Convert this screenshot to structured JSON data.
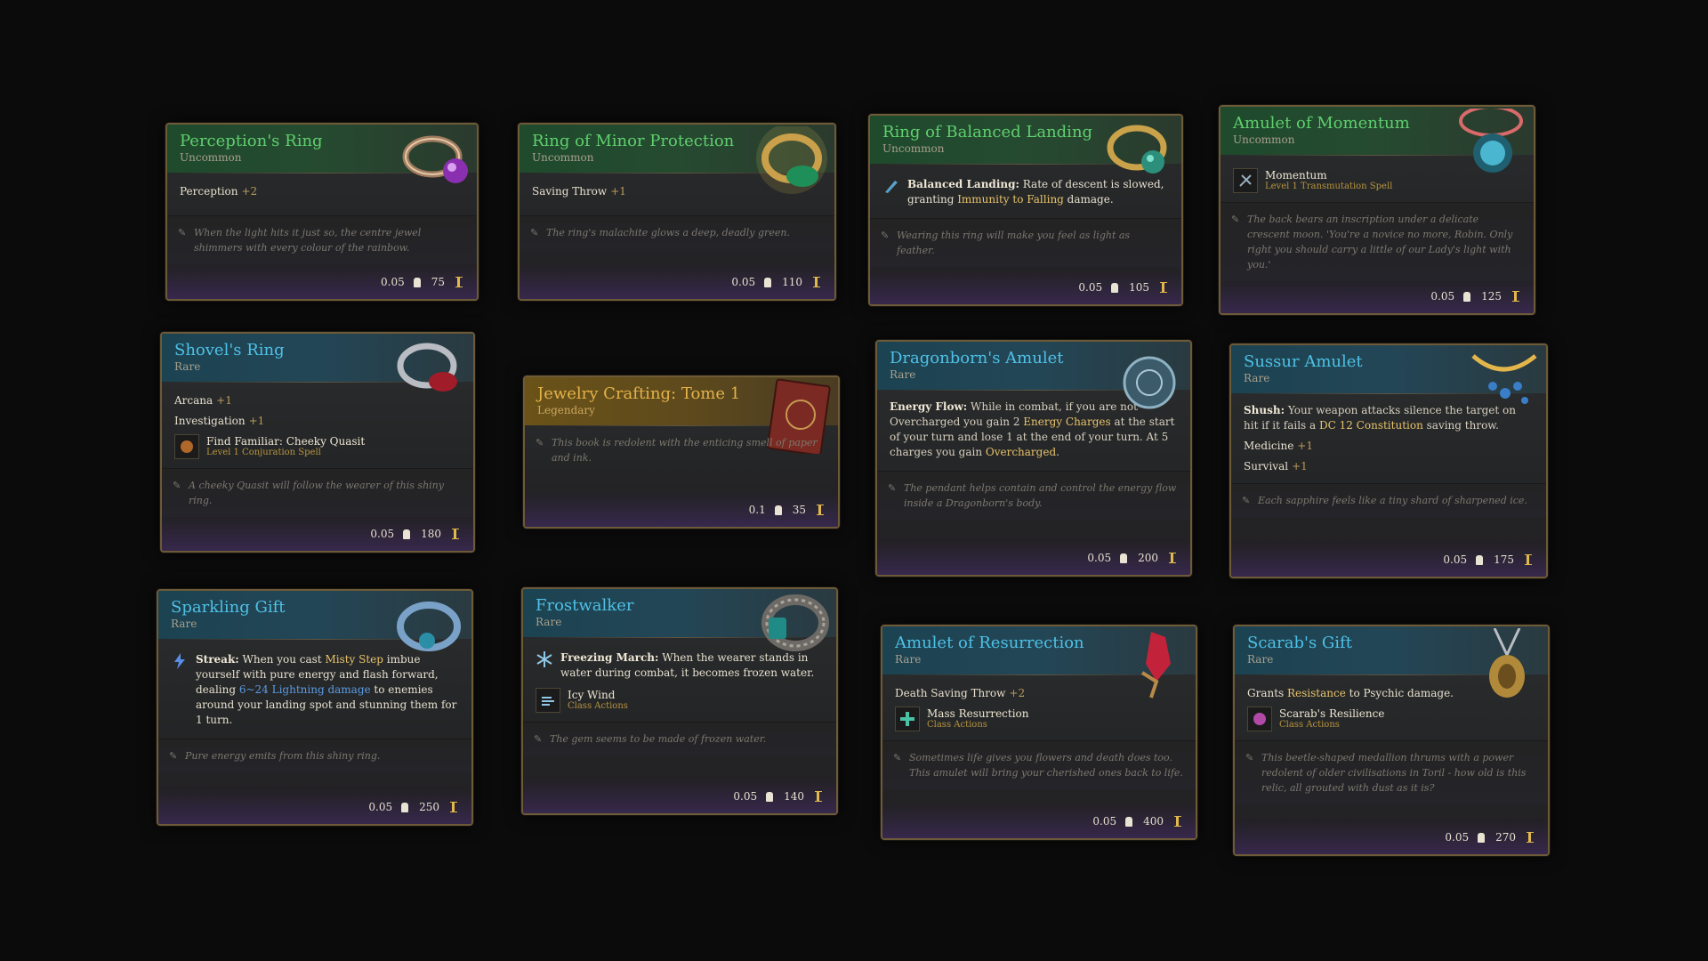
{
  "cards": [
    {
      "title": "Perception's Ring",
      "rarity": "Uncommon",
      "stats": [
        {
          "label": "Perception",
          "bonus": "+2"
        }
      ],
      "flavor": "When the light hits it just so, the centre jewel shimmers with every colour of the rainbow.",
      "weight": "0.05",
      "price": "75",
      "art": "ring-purple-gem-icon"
    },
    {
      "title": "Ring of Minor Protection",
      "rarity": "Uncommon",
      "stats": [
        {
          "label": "Saving Throw",
          "bonus": "+1"
        }
      ],
      "flavor": "The ring's malachite glows a deep, deadly green.",
      "weight": "0.05",
      "price": "110",
      "art": "ring-malachite-icon"
    },
    {
      "title": "Ring of Balanced Landing",
      "rarity": "Uncommon",
      "feature": {
        "name": "Balanced Landing:",
        "pre": " Rate of descent is slowed, granting ",
        "hl": "Immunity to Falling",
        "post": " damage."
      },
      "flavor": "Wearing this ring will make you feel as light as feather.",
      "weight": "0.05",
      "price": "105",
      "art": "ring-jade-icon"
    },
    {
      "title": "Amulet of Momentum",
      "rarity": "Uncommon",
      "spell": {
        "name": "Momentum",
        "sub": "Level 1 Transmutation Spell"
      },
      "flavor": "The back bears an inscription under a delicate crescent moon. 'You're a novice no more, Robin. Only right you should carry a little of our Lady's light with you.'",
      "weight": "0.05",
      "price": "125",
      "art": "amulet-blue-gem-icon"
    },
    {
      "title": "Shovel's Ring",
      "rarity": "Rare",
      "stats": [
        {
          "label": "Arcana",
          "bonus": "+1"
        },
        {
          "label": "Investigation",
          "bonus": "+1"
        }
      ],
      "spell": {
        "name": "Find Familiar: Cheeky Quasit",
        "sub": "Level 1 Conjuration Spell"
      },
      "flavor": "A cheeky Quasit will follow the wearer of this shiny ring.",
      "weight": "0.05",
      "price": "180",
      "art": "ring-ruby-icon"
    },
    {
      "title": "Jewelry Crafting: Tome 1",
      "rarity": "Legendary",
      "flavor": "This book is redolent with the enticing smell of paper and ink.",
      "weight": "0.1",
      "price": "35",
      "art": "tome-icon"
    },
    {
      "title": "Dragonborn's Amulet",
      "rarity": "Rare",
      "energy": {
        "name": "Energy Flow:",
        "t1": " While in combat, if you are not Overcharged you gain 2 ",
        "h1": "Energy Charges",
        "t2": " at the start of your turn and lose 1 at the end of your turn. At 5 charges you gain ",
        "h2": "Overcharged",
        "t3": "."
      },
      "flavor": "The pendant helps contain and control the energy flow inside a Dragonborn's body.",
      "weight": "0.05",
      "price": "200",
      "art": "amulet-medallion-icon"
    },
    {
      "title": "Sussur Amulet",
      "rarity": "Rare",
      "shush": {
        "name": "Shush:",
        "t1": " Your weapon attacks silence the target on hit if it fails a ",
        "h1": "DC 12 Constitution",
        "t2": " saving throw."
      },
      "stats": [
        {
          "label": "Medicine",
          "bonus": "+1"
        },
        {
          "label": "Survival",
          "bonus": "+1"
        }
      ],
      "flavor": "Each sapphire feels like a tiny shard of sharpened ice.",
      "weight": "0.05",
      "price": "175",
      "art": "amulet-sapphire-icon"
    },
    {
      "title": "Sparkling Gift",
      "rarity": "Rare",
      "streak": {
        "name": "Streak:",
        "t1": " When you cast ",
        "h1": "Misty Step",
        "t2": " imbue yourself with pure energy and flash forward, dealing ",
        "d1": "6~24 Lightning damage",
        "t3": " to enemies around your landing spot and stunning them for 1 turn."
      },
      "flavor": "Pure energy emits from this shiny ring.",
      "weight": "0.05",
      "price": "250",
      "art": "ring-sparkling-icon"
    },
    {
      "title": "Frostwalker",
      "rarity": "Rare",
      "feature": {
        "name": "Freezing March:",
        "pre": " When the wearer stands in water during combat, it becomes frozen water.",
        "hl": "",
        "post": ""
      },
      "spell": {
        "name": "Icy Wind",
        "sub": "Class Actions"
      },
      "flavor": "The gem seems to be made of frozen water.",
      "weight": "0.05",
      "price": "140",
      "art": "ring-braided-icon"
    },
    {
      "title": "Amulet of Resurrection",
      "rarity": "Rare",
      "stats": [
        {
          "label": "Death Saving Throw",
          "bonus": "+2"
        }
      ],
      "spell": {
        "name": "Mass Resurrection",
        "sub": "Class Actions"
      },
      "flavor": "Sometimes life gives you flowers and death does too. This amulet will bring your cherished ones back to life.",
      "weight": "0.05",
      "price": "400",
      "art": "amulet-red-crystal-icon"
    },
    {
      "title": "Scarab's Gift",
      "rarity": "Rare",
      "grants": {
        "pre": "Grants ",
        "hl": "Resistance",
        "post": " to Psychic damage."
      },
      "spell": {
        "name": "Scarab's Resilience",
        "sub": "Class Actions"
      },
      "flavor": "This beetle-shaped medallion thrums with a power redolent of older civilisations in Toril - how old is this relic, all grouted with dust as it is?",
      "weight": "0.05",
      "price": "270",
      "art": "amulet-scarab-icon"
    }
  ]
}
